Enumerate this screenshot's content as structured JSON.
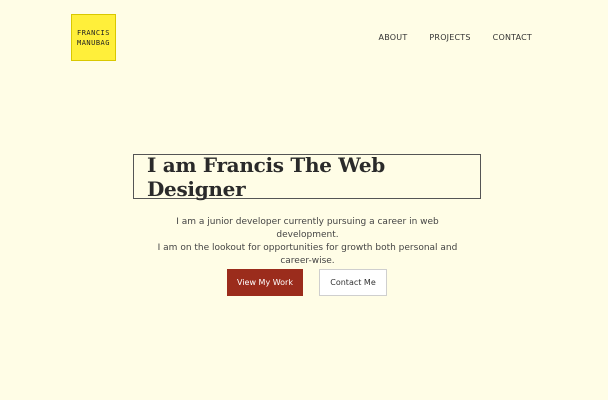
{
  "logo": {
    "line1": "FRANCIS",
    "line2": "MANUBAG"
  },
  "nav": {
    "about": "ABOUT",
    "projects": "PROJECTS",
    "contact": "CONTACT"
  },
  "hero": {
    "headline": "I am Francis The Web Designer",
    "intro_lines": [
      "I am a junior developer currently pursuing a career in web development.",
      "I am on the lookout for opportunities for growth both personal and",
      "career-wise."
    ],
    "primary_button": "View My Work",
    "secondary_button": "Contact Me"
  },
  "colors": {
    "background": "#fffde6",
    "logo_bg": "#ffef3a",
    "primary_button_bg": "#9b2c1c"
  }
}
